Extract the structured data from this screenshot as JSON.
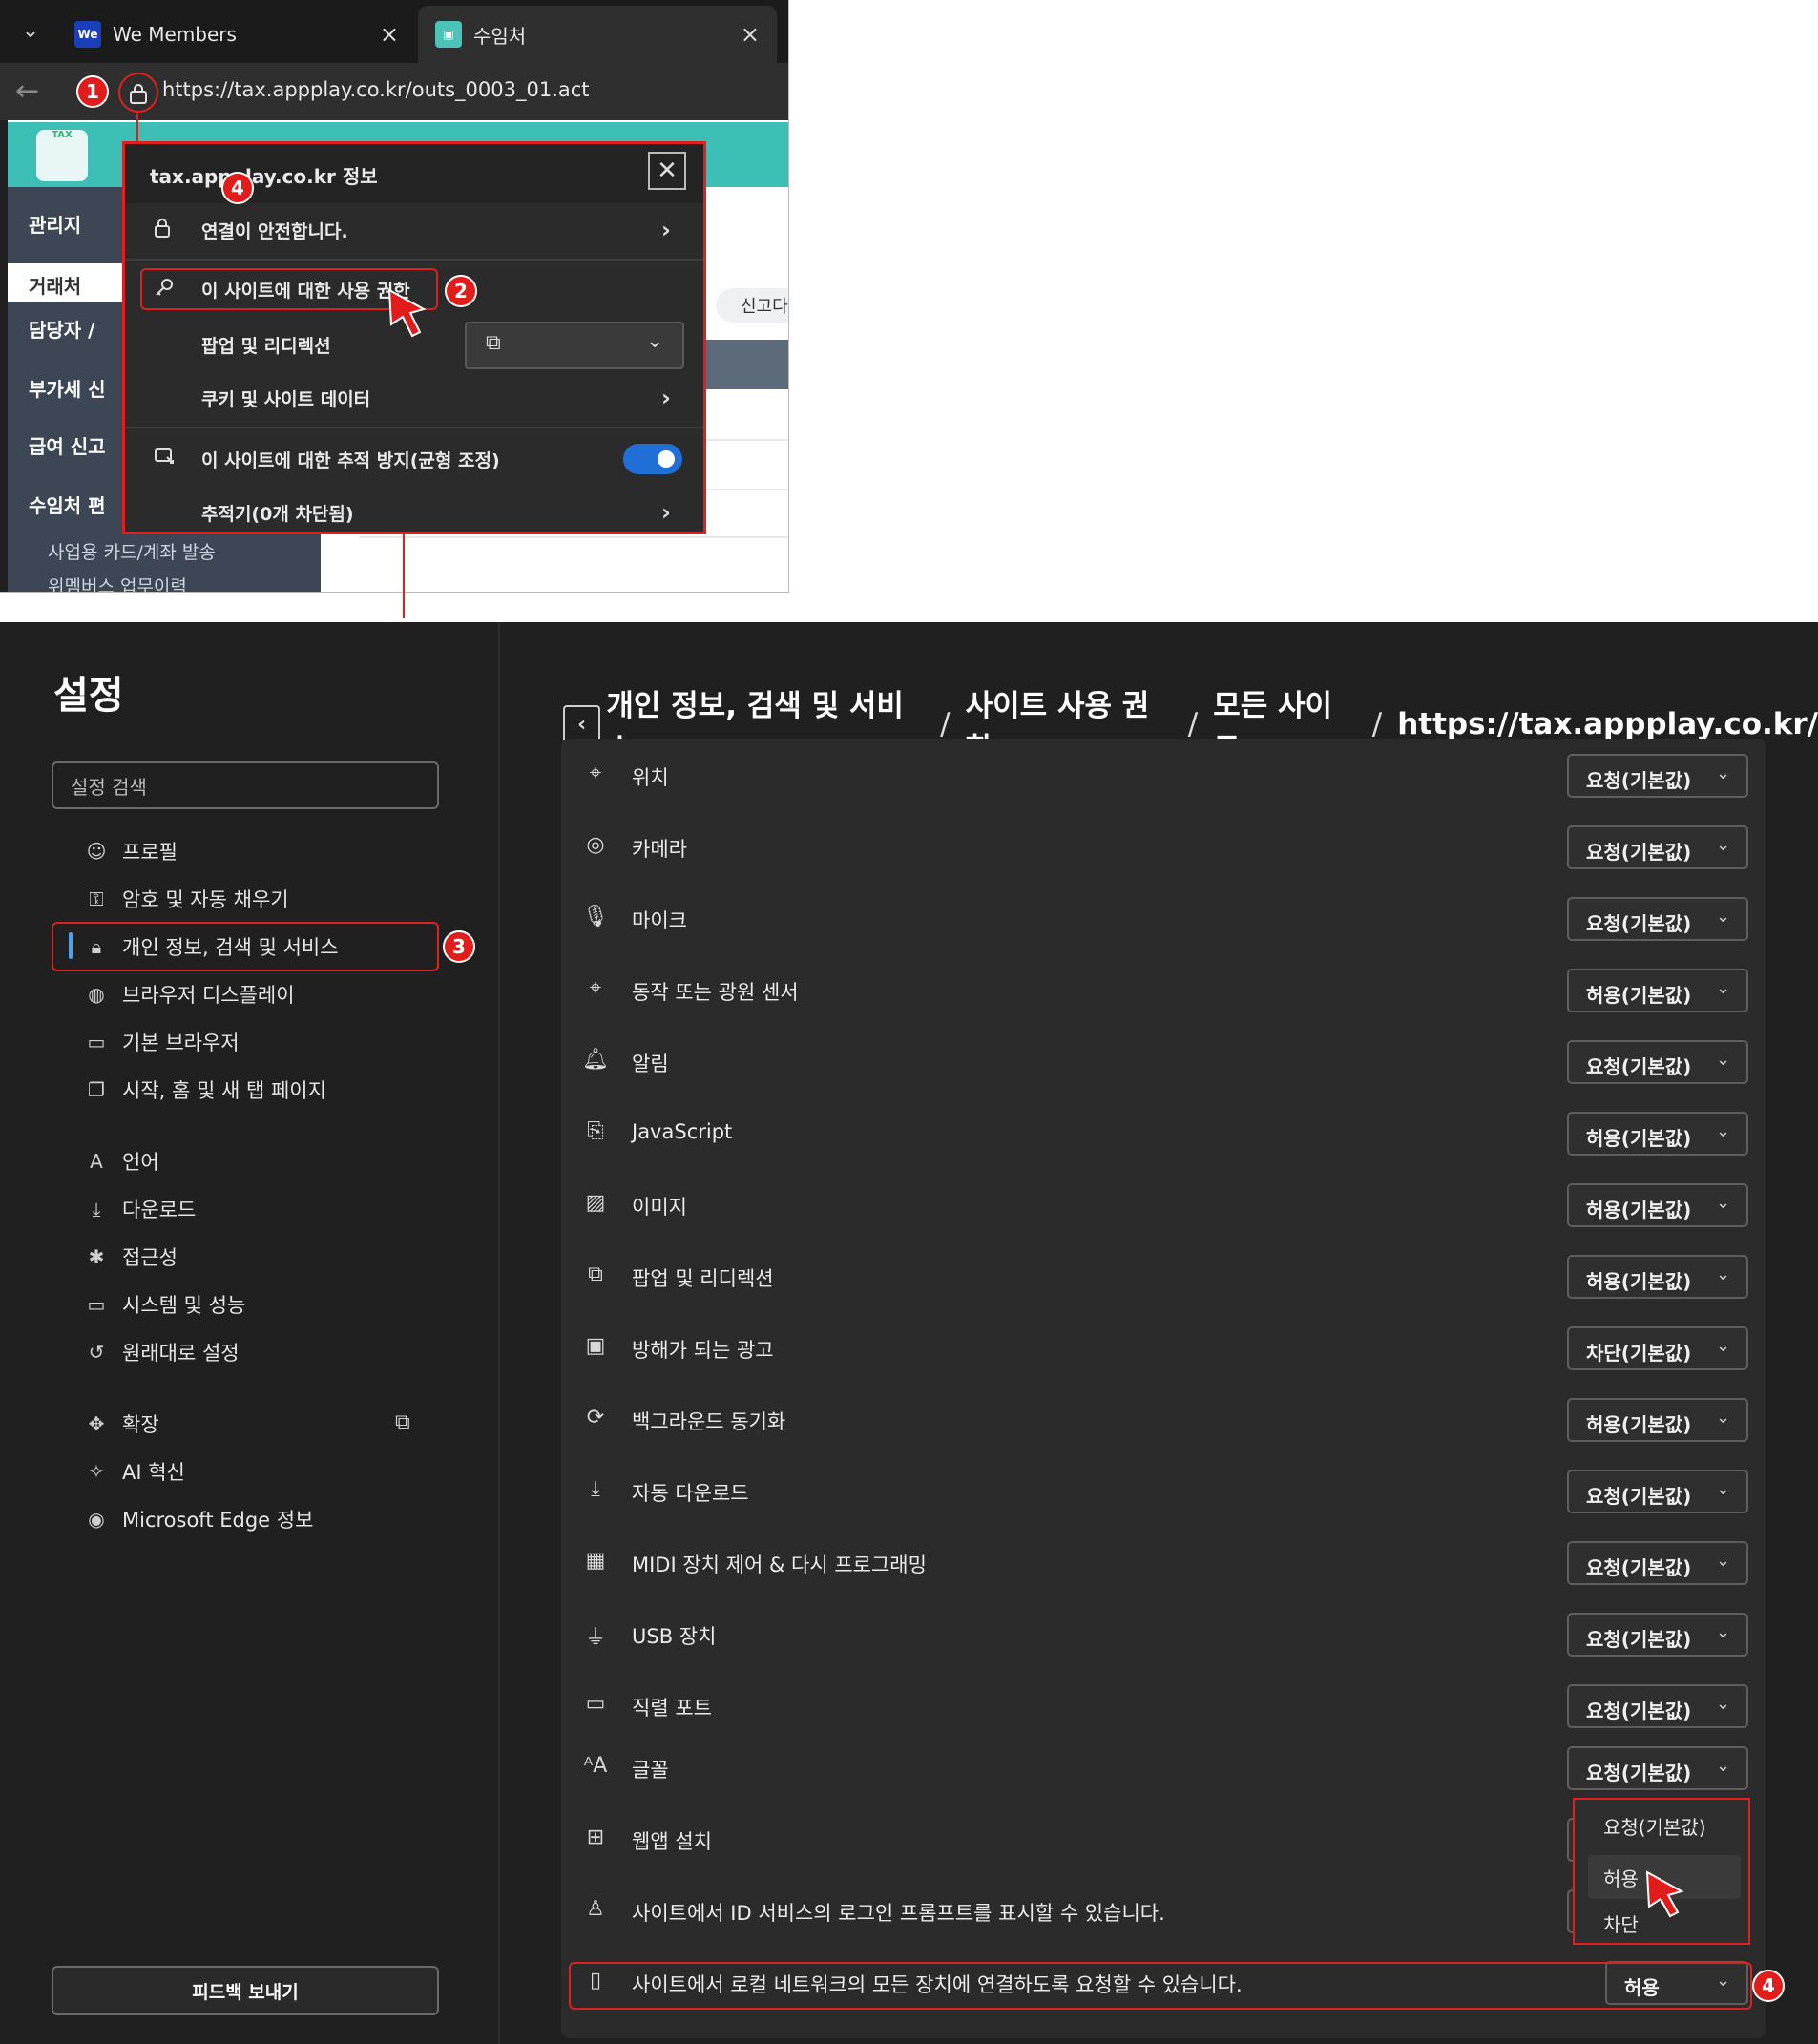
{
  "browser": {
    "tabs": [
      {
        "favicon": "We",
        "title": "We Members",
        "close": "×"
      },
      {
        "favicon": "tax-icon",
        "title": "수임처",
        "close": "×"
      }
    ],
    "url": "https://tax.appplay.co.kr/outs_0003_01.act"
  },
  "background_page": {
    "sidebar": [
      "관리지",
      "거래처",
      "담당자 /",
      "부가세 신",
      "급여 신고",
      "수임처 편"
    ],
    "sidebar_sub": [
      "사업용 카드/계좌 발송",
      "위멤버스 업무이력"
    ],
    "report_button": "신고다",
    "logo_text": "TAX"
  },
  "site_info_popup": {
    "title": "tax.appplay.co.kr 정보",
    "connection": "연결이 안전합니다.",
    "permissions": "이 사이트에 대한 사용 권한",
    "popups": "팝업 및 리디렉션",
    "cookies": "쿠키 및 사이트 데이터",
    "tracking": "이 사이트에 대한 추적 방지(균형 조정)",
    "trackers": "추적기(0개 차단됨)",
    "tracking_enabled": true
  },
  "settings": {
    "title": "설정",
    "search_placeholder": "설정 검색",
    "nav": [
      {
        "label": "프로필",
        "icon": "profile-icon"
      },
      {
        "label": "암호 및 자동 채우기",
        "icon": "key-icon"
      },
      {
        "label": "개인 정보, 검색 및 서비스",
        "icon": "lock-icon",
        "selected": true
      },
      {
        "label": "브라우저 디스플레이",
        "icon": "palette-icon"
      },
      {
        "label": "기본 브라우저",
        "icon": "browser-icon"
      },
      {
        "label": "시작, 홈 및 새 탭 페이지",
        "icon": "newtab-icon"
      },
      {
        "label": "언어",
        "icon": "language-icon"
      },
      {
        "label": "다운로드",
        "icon": "download-icon"
      },
      {
        "label": "접근성",
        "icon": "accessibility-icon"
      },
      {
        "label": "시스템 및 성능",
        "icon": "laptop-icon"
      },
      {
        "label": "원래대로 설정",
        "icon": "reset-icon"
      },
      {
        "label": "확장",
        "icon": "extension-icon"
      },
      {
        "label": "AI 혁신",
        "icon": "ai-icon"
      },
      {
        "label": "Microsoft Edge 정보",
        "icon": "edge-icon"
      }
    ],
    "feedback": "피드백 보내기",
    "breadcrumb": [
      "개인 정보, 검색 및 서비스",
      "사이트 사용 권한",
      "모든 사이트",
      "https://tax.appplay.co.kr/"
    ],
    "breadcrumb_sep": "/",
    "permissions": [
      {
        "label": "위치",
        "value": "요청(기본값)",
        "icon": "location-icon"
      },
      {
        "label": "카메라",
        "value": "요청(기본값)",
        "icon": "camera-icon"
      },
      {
        "label": "마이크",
        "value": "요청(기본값)",
        "icon": "mic-icon"
      },
      {
        "label": "동작 또는 광원 센서",
        "value": "허용(기본값)",
        "icon": "sensor-icon"
      },
      {
        "label": "알림",
        "value": "요청(기본값)",
        "icon": "bell-icon"
      },
      {
        "label": "JavaScript",
        "value": "허용(기본값)",
        "icon": "js-icon"
      },
      {
        "label": "이미지",
        "value": "허용(기본값)",
        "icon": "image-icon"
      },
      {
        "label": "팝업 및 리디렉션",
        "value": "허용(기본값)",
        "icon": "popup-icon"
      },
      {
        "label": "방해가 되는 광고",
        "value": "차단(기본값)",
        "icon": "ads-icon"
      },
      {
        "label": "백그라운드 동기화",
        "value": "허용(기본값)",
        "icon": "sync-icon"
      },
      {
        "label": "자동 다운로드",
        "value": "요청(기본값)",
        "icon": "download-icon"
      },
      {
        "label": "MIDI 장치 제어 & 다시 프로그래밍",
        "value": "요청(기본값)",
        "icon": "midi-icon"
      },
      {
        "label": "USB 장치",
        "value": "요청(기본값)",
        "icon": "usb-icon"
      },
      {
        "label": "직렬 포트",
        "value": "요청(기본값)",
        "icon": "serial-icon"
      },
      {
        "label": "글꼴",
        "value": "요청(기본값)",
        "icon": "font-icon"
      },
      {
        "label": "웹앱 설치",
        "value": "",
        "icon": "app-install-icon"
      },
      {
        "label": "사이트에서 ID 서비스의 로그인 프롬프트를 표시할 수 있습니다.",
        "value": "",
        "icon": "person-icon"
      },
      {
        "label": "사이트에서 로컬 네트워크의 모든 장치에 연결하도록 요청할 수 있습니다.",
        "value": "허용",
        "icon": "local-network-icon"
      }
    ],
    "dropdown_options": [
      "요청(기본값)",
      "허용",
      "차단"
    ]
  },
  "annotations": {
    "step1": "1",
    "step2": "2",
    "step3": "3",
    "step4a": "4",
    "step4b": "4"
  },
  "colors": {
    "accent_red": "#e02020",
    "badge_red": "#e21b1b",
    "toggle_blue": "#1f6fd6",
    "teal": "#3ebfb5"
  }
}
